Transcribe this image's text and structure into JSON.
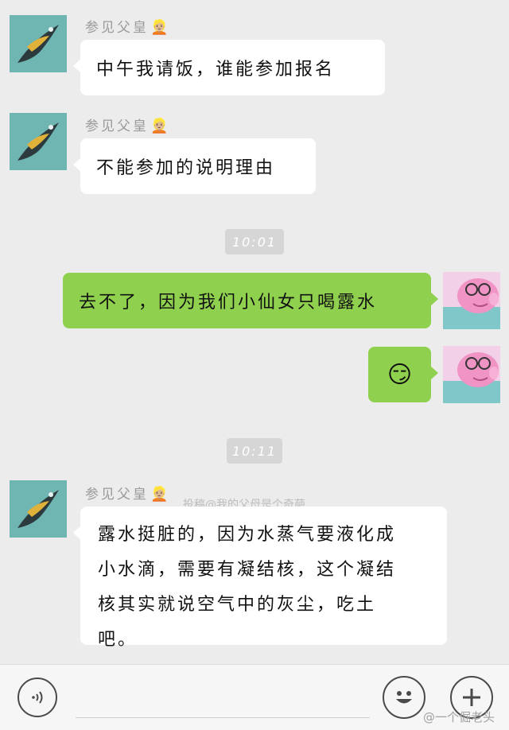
{
  "messages": [
    {
      "sender": "参见父皇",
      "sender_emoji": "👱🏼",
      "text": "中午我请饭，谁能参加报名"
    },
    {
      "sender": "参见父皇",
      "sender_emoji": "👱🏼",
      "text": "不能参加的说明理由"
    },
    {
      "timestamp": "10:01"
    },
    {
      "text": "去不了，因为我们小仙女只喝露水"
    },
    {
      "text": "😏"
    },
    {
      "timestamp": "10:11"
    },
    {
      "sender": "参见父皇",
      "sender_emoji": "👱🏼",
      "lines": [
        "露水挺脏的，因为水蒸气要液化成",
        "小水滴，需要有凝结核，这个凝结",
        "核其实就说空气中的灰尘，吃土",
        "吧。"
      ]
    }
  ],
  "watermark": "投稿@我的父母是个奇葩",
  "footer_credit": "@一个倔老头",
  "icons": {
    "voice": "voice-icon",
    "emoji": "smiley-icon",
    "add": "plus-icon"
  },
  "colors": {
    "background": "#ececec",
    "bubble_left": "#ffffff",
    "bubble_right": "#8fd14f"
  }
}
